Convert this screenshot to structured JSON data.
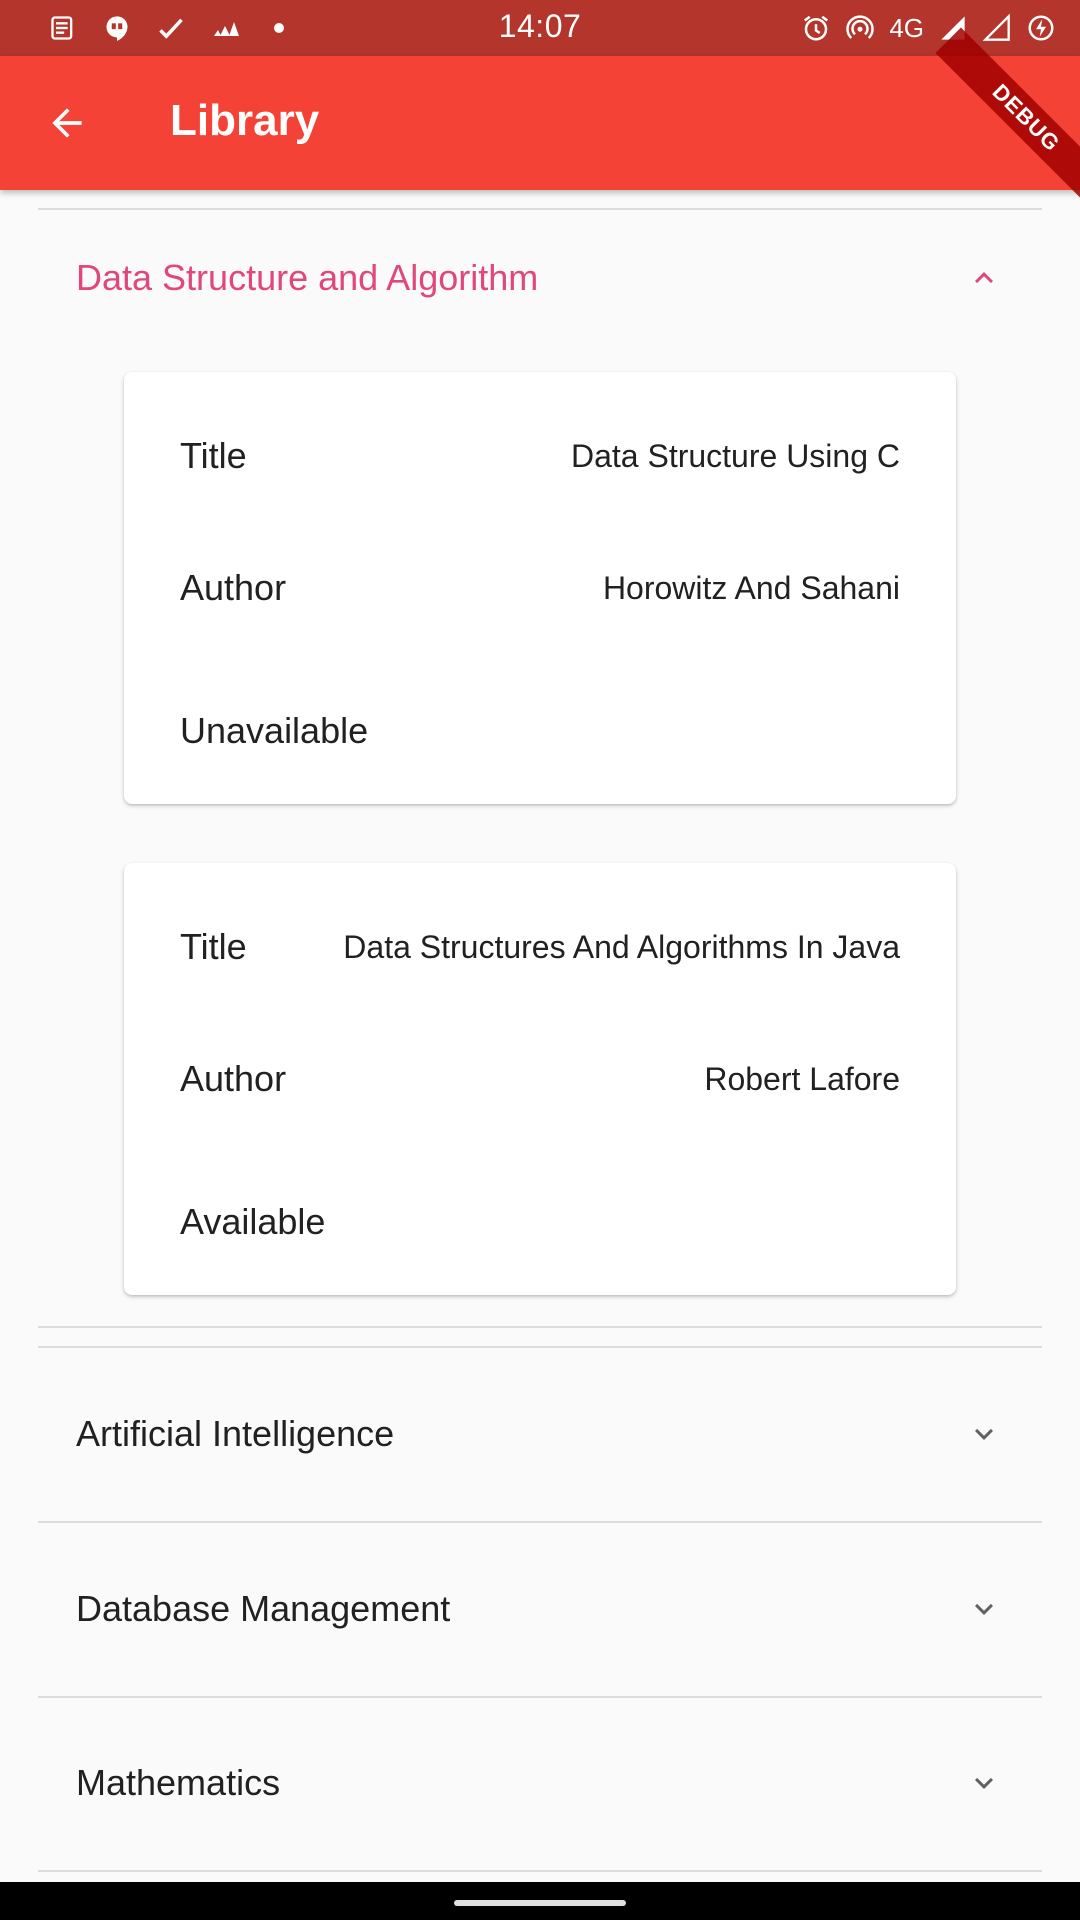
{
  "status_bar": {
    "time": "14:07",
    "network": "4G",
    "left_icons": [
      "news-icon",
      "hangouts-icon",
      "check-icon",
      "adidas-icon",
      "dot-icon"
    ],
    "right_icons": [
      "alarm-icon",
      "hotspot-icon",
      "signal-icon",
      "signal-icon",
      "battery-icon"
    ]
  },
  "app_bar": {
    "title": "Library",
    "debug_banner": "DEBUG",
    "color": "#f44336"
  },
  "sections": [
    {
      "label": "Data Structure and Algorithm",
      "expanded": true,
      "accent": "#e0477a",
      "books": [
        {
          "title_label": "Title",
          "title": "Data Structure Using C",
          "author_label": "Author",
          "author": "Horowitz And Sahani",
          "status": "Unavailable"
        },
        {
          "title_label": "Title",
          "title": "Data Structures And Algorithms In Java",
          "author_label": "Author",
          "author": "Robert Lafore",
          "status": "Available"
        }
      ]
    },
    {
      "label": "Artificial Intelligence",
      "expanded": false
    },
    {
      "label": "Database Management",
      "expanded": false
    },
    {
      "label": "Mathematics",
      "expanded": false
    }
  ]
}
